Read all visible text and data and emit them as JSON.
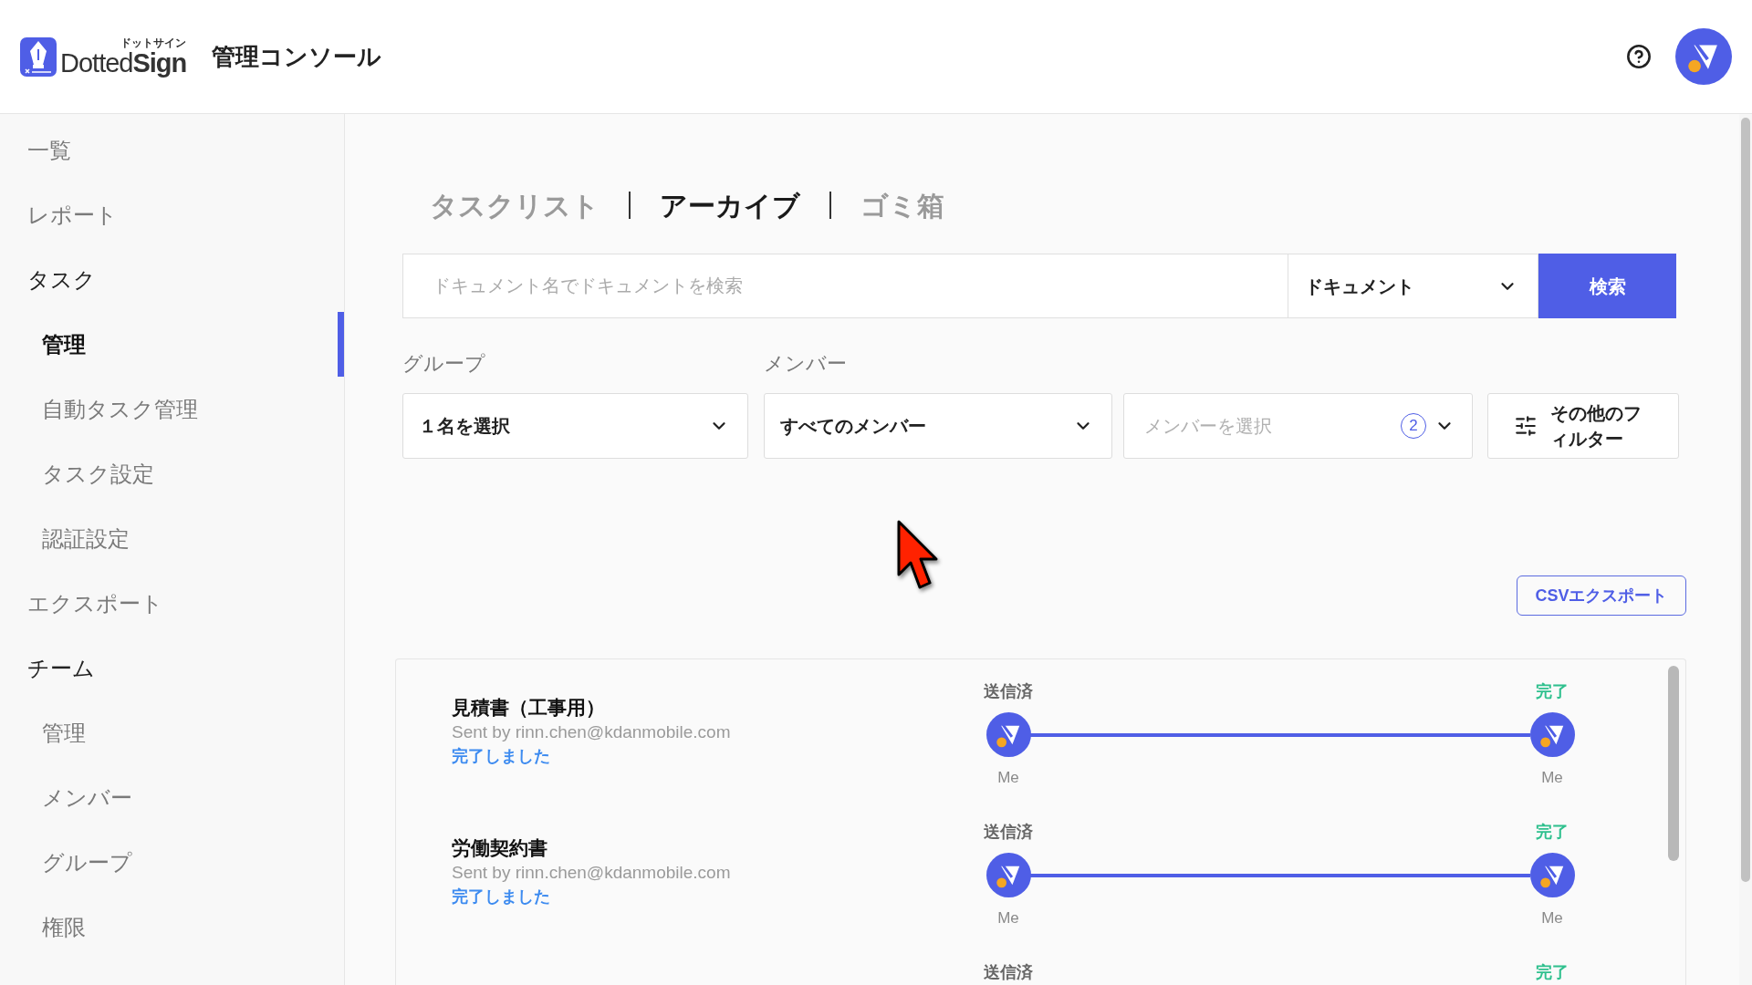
{
  "header": {
    "logo": {
      "kana": "ドットサイン",
      "wordmark": "Dotted**Sign**"
    },
    "title": "管理コンソール"
  },
  "sidebar": {
    "items": [
      {
        "label": "一覧",
        "selected": false
      },
      {
        "label": "レポート",
        "selected": false
      },
      {
        "label": "タスク",
        "selected": false,
        "children": [
          {
            "label": "管理",
            "selected": true
          },
          {
            "label": "自動タスク管理",
            "selected": false
          },
          {
            "label": "タスク設定",
            "selected": false
          },
          {
            "label": "認証設定",
            "selected": false
          }
        ]
      },
      {
        "label": "エクスポート",
        "selected": false
      },
      {
        "label": "チーム",
        "selected": false,
        "children": [
          {
            "label": "管理",
            "selected": false
          },
          {
            "label": "メンバー",
            "selected": false
          },
          {
            "label": "グループ",
            "selected": false
          },
          {
            "label": "権限",
            "selected": false
          }
        ]
      }
    ]
  },
  "tabs": [
    {
      "label": "タスクリスト",
      "selected": false
    },
    {
      "label": "アーカイブ",
      "selected": true
    },
    {
      "label": "ゴミ箱",
      "selected": false
    }
  ],
  "search": {
    "placeholder": "ドキュメント名でドキュメントを検索",
    "scope": "ドキュメント",
    "button": "検索"
  },
  "filters": {
    "group": {
      "label": "グループ",
      "value": "１名を選択"
    },
    "member": {
      "label": "メンバー",
      "value": "すべてのメンバー"
    },
    "member_pick": {
      "placeholder": "メンバーを選択",
      "count": "2"
    },
    "more": "その他のフィルター"
  },
  "export_button": "CSVエクスポート",
  "tasks": [
    {
      "title": "見積書（工事用）",
      "sender": "Sent by rinn.chen@kdanmobile.com",
      "status": "完了しました",
      "steps": [
        {
          "kind": "sent",
          "label": "送信済",
          "signer": "Me"
        },
        {
          "kind": "done",
          "label": "完了",
          "signer": "Me"
        }
      ]
    },
    {
      "title": "労働契約書",
      "sender": "Sent by rinn.chen@kdanmobile.com",
      "status": "完了しました",
      "steps": [
        {
          "kind": "sent",
          "label": "送信済",
          "signer": "Me"
        },
        {
          "kind": "done",
          "label": "完了",
          "signer": "Me"
        }
      ]
    },
    {
      "steps": [
        {
          "kind": "sent",
          "label": "送信済"
        },
        {
          "kind": "done",
          "label": "完了"
        }
      ]
    }
  ]
}
